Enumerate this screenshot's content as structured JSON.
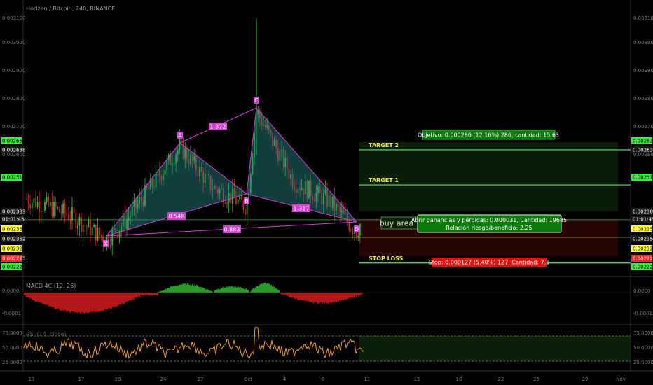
{
  "header": {
    "title": "Horizen / Bitcoin, 240, BINANCE"
  },
  "macd": {
    "label": "MACD 4C (12, 26)",
    "ticks": [
      "0.0000",
      "-0.0001"
    ]
  },
  "rsi": {
    "label": "RSI (14, close)",
    "ticks": [
      "75.0000",
      "50.0000",
      "25.0000"
    ]
  },
  "trade": {
    "target2_label": "TARGET 2",
    "target1_label": "TARGET 1",
    "stop_label": "STOP LOSS",
    "buy_label": "buy area",
    "target2_info": "Objetivo: 0.000286 (12.16%) 286, cantidad: 15.63",
    "position_info": "Abrir ganancias y pérdidas: 0.000031, Cantidad: 19685",
    "risk_reward": "Relación riesgo/beneficio: 2.25",
    "stop_info": "Stop: 0.000127 (5.40%) 127, Cantidad: 7.5"
  },
  "colors": {
    "bull": "#2eb82e",
    "bear": "#d01c1c",
    "pattern": "#d43fd4",
    "pattern_fill": "#2a8a8a",
    "level_line": "#5ce65c",
    "macd_pos": "#2eb82e",
    "macd_neg": "#d01c1c",
    "rsi_line": "#f0a030",
    "label_green": "#3ee83e",
    "label_yellow": "#ffff33",
    "label_red": "#ff2020"
  },
  "chart_data": {
    "type": "candlestick",
    "price_axis": {
      "range": [
        0.00219,
        0.00312
      ],
      "ticks": [
        "0.003100",
        "0.003000",
        "0.002900",
        "0.002800",
        "0.002700",
        "0.002600",
        "0.002510",
        "0.002400",
        "0.002300",
        "0.002200"
      ],
      "tags": [
        {
          "value": "0.002638",
          "kind": "green"
        },
        {
          "value": "0.002638",
          "kind": "dark"
        },
        {
          "value": "0.002510",
          "kind": "green"
        },
        {
          "value": "0.002383",
          "kind": "dark"
        },
        {
          "value": "01:01:45",
          "kind": "dark"
        },
        {
          "value": "0.002359",
          "kind": "yellow"
        },
        {
          "value": "0.002352",
          "kind": "dark"
        },
        {
          "value": "0.002324",
          "kind": "yellow"
        },
        {
          "value": "0.002225",
          "kind": "red"
        },
        {
          "value": "0.002220",
          "kind": "green"
        }
      ]
    },
    "levels": [
      {
        "name": "TARGET 2",
        "price": 0.002638
      },
      {
        "name": "TARGET 1",
        "price": 0.00251
      },
      {
        "name": "entry",
        "price": 0.002383
      },
      {
        "name": "buy",
        "price": 0.002352
      },
      {
        "name": "STOP LOSS",
        "price": 0.002225
      }
    ],
    "pattern": {
      "points": [
        {
          "label": "X",
          "price": 0.00231
        },
        {
          "label": "A",
          "price": 0.00265
        },
        {
          "label": "B",
          "price": 0.00243
        },
        {
          "label": "C",
          "price": 0.00278
        },
        {
          "label": "D",
          "price": 0.00234
        }
      ],
      "ratios": [
        "1.372",
        "0.548",
        "1.317",
        "0.883"
      ]
    },
    "x_ticks": [
      "13",
      "17",
      "20",
      "24",
      "27",
      "Oct",
      "4",
      "8",
      "11",
      "15",
      "18",
      "22",
      "25",
      "29",
      "Nov"
    ]
  }
}
